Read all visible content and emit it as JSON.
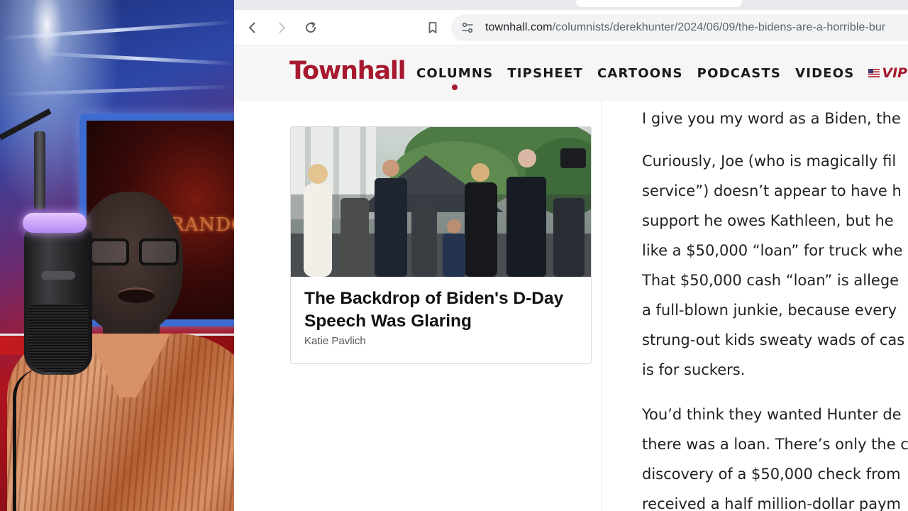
{
  "browser": {
    "url_domain": "townhall.com",
    "url_path": "/columnists/derekhunter/2024/06/09/the-bidens-are-a-horrible-bur"
  },
  "site": {
    "logo": "Townhall",
    "nav": [
      "COLUMNS",
      "TIPSHEET",
      "CARTOONS",
      "PODCASTS",
      "VIDEOS"
    ],
    "active_nav": "COLUMNS",
    "vip_label": "VIP",
    "accent_color": "#a6192e"
  },
  "webcam": {
    "background_screen_text": "RANDO"
  },
  "card": {
    "title": "The Backdrop of Biden's D-Day Speech Was Glaring",
    "author": "Katie Pavlich"
  },
  "article": {
    "paragraphs": [
      [
        "I give you my word as a Biden, the"
      ],
      [
        "Curiously, Joe (who is magically fil",
        "service”) doesn’t appear to have h",
        "support he owes Kathleen, but he",
        "like a $50,000 “loan” for truck whe",
        "That $50,000 cash “loan” is allege",
        "a full-blown junkie, because every",
        "strung-out kids sweaty wads of cas",
        "is for suckers."
      ],
      [
        "You’d think they wanted Hunter de",
        "there was a loan. There’s only the c",
        "discovery of a $50,000 check from",
        "received a half million-dollar paym"
      ]
    ]
  }
}
